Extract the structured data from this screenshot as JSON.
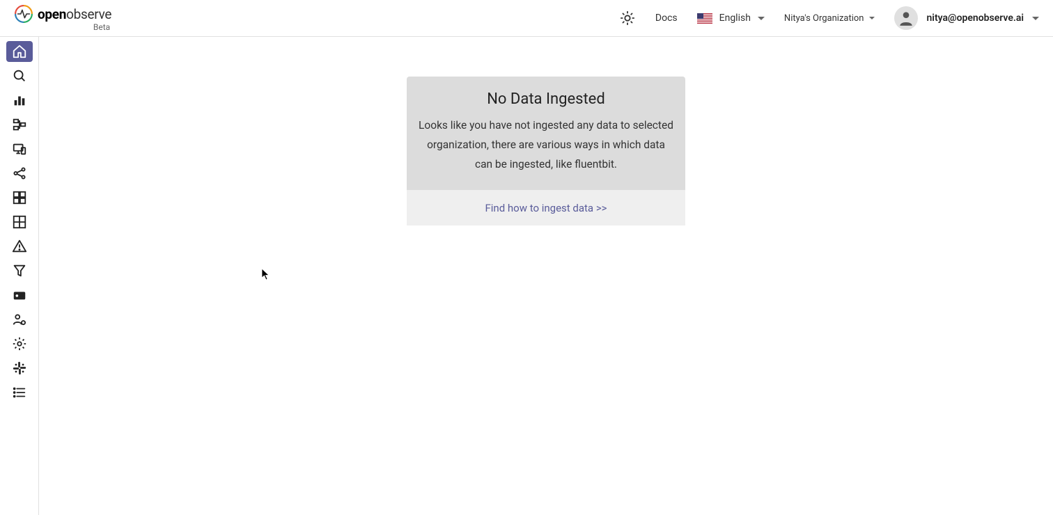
{
  "header": {
    "brand_open": "open",
    "brand_observe": "observe",
    "beta": "Beta",
    "docs": "Docs",
    "language": "English",
    "organization": "Nitya's Organization",
    "user_email": "nitya@openobserve.ai"
  },
  "sidebar": {
    "items": [
      {
        "name": "home",
        "active": true
      },
      {
        "name": "search"
      },
      {
        "name": "metrics"
      },
      {
        "name": "traces"
      },
      {
        "name": "rum"
      },
      {
        "name": "pipelines"
      },
      {
        "name": "dashboards"
      },
      {
        "name": "streams"
      },
      {
        "name": "alerts"
      },
      {
        "name": "functions"
      },
      {
        "name": "ingestion"
      },
      {
        "name": "iam"
      },
      {
        "name": "settings"
      },
      {
        "name": "slack"
      },
      {
        "name": "list"
      }
    ]
  },
  "empty_state": {
    "title": "No Data Ingested",
    "description": "Looks like you have not ingested any data to selected organization, there are various ways in which data can be ingested, like fluentbit.",
    "link": "Find how to ingest data >>"
  }
}
